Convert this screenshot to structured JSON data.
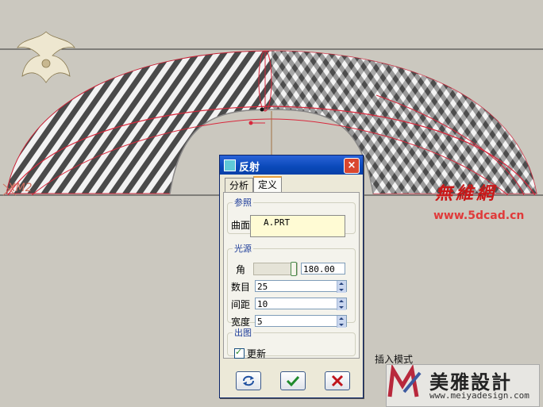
{
  "dialog": {
    "title": "反射",
    "close_label": "×",
    "tabs": [
      "分析",
      "定义"
    ],
    "active_tab": "定义",
    "reference": {
      "legend": "参照",
      "surface_label": "曲面",
      "surface_value": "A.PRT"
    },
    "light": {
      "legend": "光源",
      "angle_label": "角",
      "angle_value": "180.00",
      "angle_slider_fraction": 1.0,
      "count_label": "数目",
      "count_value": "25",
      "spacing_label": "间距",
      "spacing_value": "10",
      "width_label": "宽度",
      "width_value": "5"
    },
    "output": {
      "legend": "出图",
      "update_label": "更新",
      "update_checked": true
    },
    "buttons": {
      "refresh_icon": "refresh-icon",
      "ok_icon": "checkmark-icon",
      "cancel_icon": "x-icon"
    }
  },
  "viewport": {
    "csys_label": "XM2",
    "mode_label": "插入模式"
  },
  "watermarks": {
    "site_cn": "無維網",
    "site_url": "www.5dcad.cn",
    "brand_cn": "美雅設計",
    "brand_url": "www.meiyadesign.com"
  },
  "colors": {
    "curve_red": "#d8283c",
    "dialog_title": "#0a49b9",
    "surface_box": "#fffbd4"
  }
}
